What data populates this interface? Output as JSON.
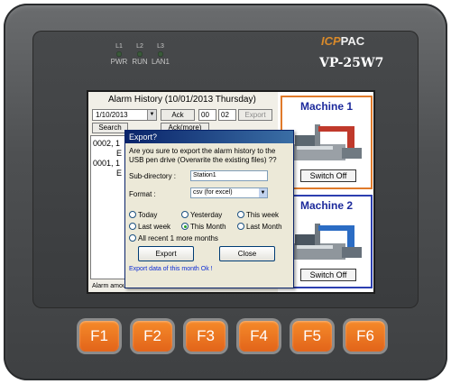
{
  "device": {
    "brand_prefix": "ICP",
    "brand_suffix": "PAC",
    "model": "VP-25W7",
    "leds": [
      {
        "top": "L1",
        "bottom": "PWR"
      },
      {
        "top": "L2",
        "bottom": "RUN"
      },
      {
        "top": "L3",
        "bottom": "LAN1"
      }
    ],
    "function_keys": [
      "F1",
      "F2",
      "F3",
      "F4",
      "F5",
      "F6"
    ]
  },
  "alarm": {
    "title": "Alarm History (10/01/2013 Thursday)",
    "date": "1/10/2013",
    "ack": "Ack",
    "hour": "00",
    "minute": "02",
    "export": "Export",
    "search": "Search",
    "ack_more": "Ack(more)",
    "rows": [
      "0002, 1",
      "E",
      "0001, 1",
      "E"
    ],
    "status": "Alarm amoun"
  },
  "machines": [
    {
      "title": "Machine 1",
      "button": "Switch Off",
      "border": "#e07a2a"
    },
    {
      "title": "Machine 2",
      "button": "Switch Off",
      "border": "#2c3fb0"
    }
  ],
  "dialog": {
    "title": "Export?",
    "message": "Are you sure to export the alarm history to the USB pen drive (Overwrite the existing files) ??",
    "subdir_label": "Sub-directory :",
    "subdir_value": "Station1",
    "format_label": "Format :",
    "format_value": "csv (for excel)",
    "options": [
      "Today",
      "Yesterday",
      "This week",
      "Last week",
      "This Month",
      "Last Month",
      "All recent 1 more months"
    ],
    "selected": "This Month",
    "export_button": "Export",
    "close_button": "Close",
    "status": "Export data of this month Ok !"
  },
  "colors": {
    "fkey": "#e2641a",
    "machine1_border": "#e07a2a",
    "machine2_border": "#2c3fb0",
    "title_bar": "#0a246a"
  }
}
